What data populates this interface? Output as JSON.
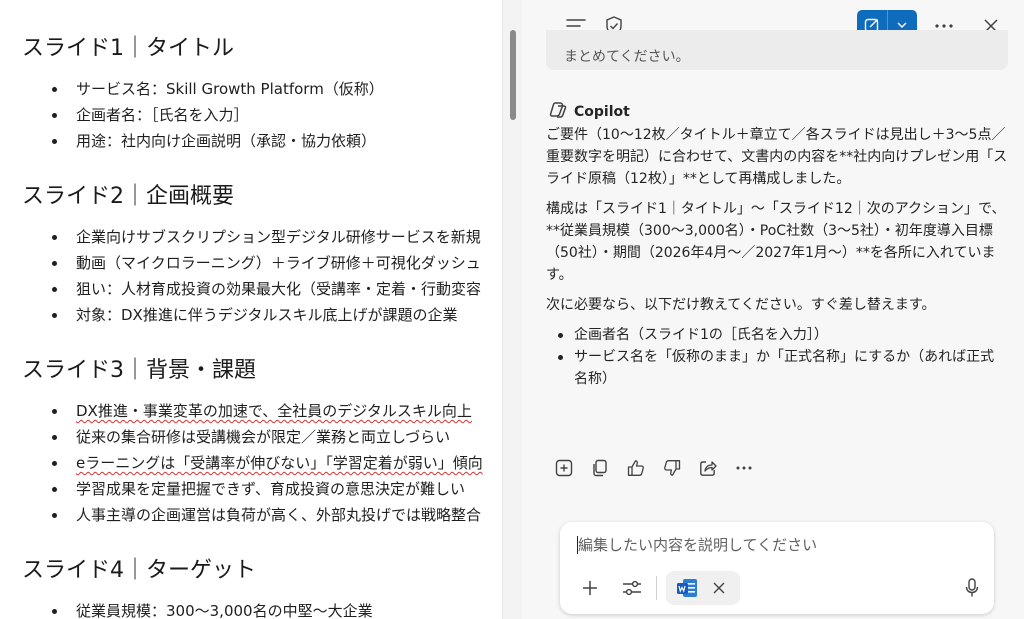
{
  "document": {
    "slides": [
      {
        "title": "スライド1｜タイトル",
        "bullets": [
          "サービス名：Skill Growth Platform（仮称）",
          "企画者名：［氏名を入力］",
          "用途：社内向け企画説明（承認・協力依頼）"
        ]
      },
      {
        "title": "スライド2｜企画概要",
        "bullets": [
          "企業向けサブスクリプション型デジタル研修サービスを新規",
          "動画（マイクロラーニング）＋ライブ研修＋可視化ダッシュ",
          "狙い：人材育成投資の効果最大化（受講率・定着・行動変容",
          "対象：DX推進に伴うデジタルスキル底上げが課題の企業"
        ]
      },
      {
        "title": "スライド3｜背景・課題",
        "bullets": [
          "DX推進・事業変革の加速で、全社員のデジタルスキル向上",
          "従来の集合研修は受講機会が限定／業務と両立しづらい",
          "eラーニングは「受講率が伸びない」「学習定着が弱い」傾向",
          "学習成果を定量把握できず、育成投資の意思決定が難しい",
          "人事主導の企画運営は負荷が高く、外部丸投げでは戦略整合"
        ]
      },
      {
        "title": "スライド4｜ターゲット",
        "bullets": [
          "従業員規模：300〜3,000名の中堅〜大企業"
        ]
      }
    ]
  },
  "copilot": {
    "prev_message": "まとめてください。",
    "name": "Copilot",
    "paragraphs": [
      "ご要件（10〜12枚／タイトル＋章立て／各スライドは見出し＋3〜5点／重要数字を明記）に合わせて、文書内の内容を**社内向けプレゼン用「スライド原稿（12枚）」**として再構成しました。",
      "構成は「スライド1｜タイトル」〜「スライド12｜次のアクション」で、**従業員規模（300〜3,000名）・PoC社数（3〜5社）・初年度導入目標（50社）・期間（2026年4月〜／2027年1月〜）**を各所に入れています。",
      "次に必要なら、以下だけ教えてください。すぐ差し替えます。"
    ],
    "bullets": [
      "企画者名（スライド1の［氏名を入力］）",
      "サービス名を「仮称のまま」か「正式名称」にするか（あれば正式名称）"
    ],
    "composer": {
      "placeholder": "編集したい内容を説明してください",
      "attachment_icon": "word-document-icon"
    }
  },
  "colors": {
    "accent": "#0f6cbd",
    "spellcheck": "#d13438"
  }
}
